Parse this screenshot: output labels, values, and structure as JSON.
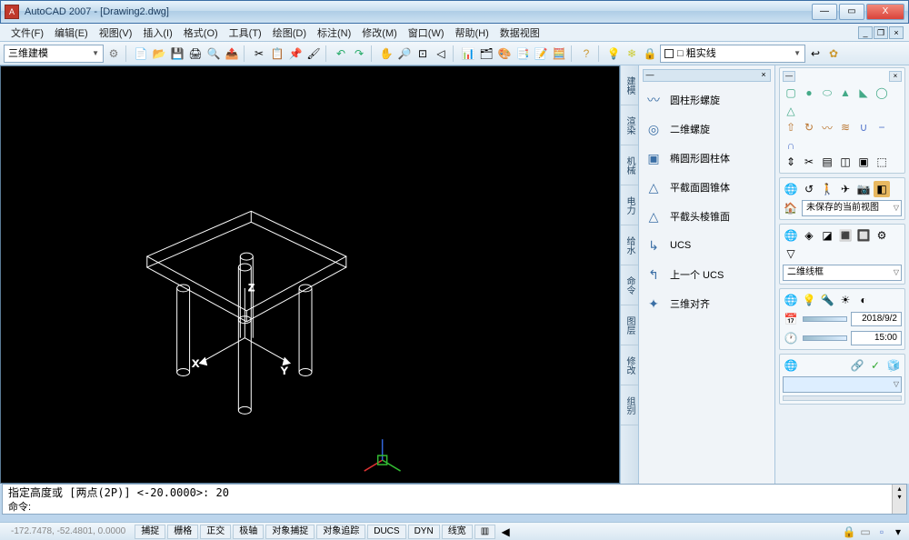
{
  "window": {
    "title": "AutoCAD 2007 - [Drawing2.dwg]",
    "min": "—",
    "max": "▭",
    "close": "X"
  },
  "mdi": {
    "min": "_",
    "restore": "❐",
    "close": "×"
  },
  "menus": [
    "文件(F)",
    "编辑(E)",
    "视图(V)",
    "插入(I)",
    "格式(O)",
    "工具(T)",
    "绘图(D)",
    "标注(N)",
    "修改(M)",
    "窗口(W)",
    "帮助(H)",
    "数据视图"
  ],
  "workspace": {
    "selected": "三维建模"
  },
  "layer": {
    "combo": "□ 粗实线"
  },
  "right_panel": {
    "tabs": [
      "建模",
      "渲染",
      "机械",
      "电力",
      "给水",
      "命令",
      "图层",
      "修改",
      "组别"
    ],
    "items": [
      {
        "icon": "〰",
        "label": "圆柱形螺旋"
      },
      {
        "icon": "◎",
        "label": "二维螺旋"
      },
      {
        "icon": "▣",
        "label": "椭圆形圆柱体"
      },
      {
        "icon": "△",
        "label": "平截面圆锥体"
      },
      {
        "icon": "△",
        "label": "平截头棱锥面"
      },
      {
        "icon": "↳",
        "label": "UCS"
      },
      {
        "icon": "↰",
        "label": "上一个 UCS"
      },
      {
        "icon": "✦",
        "label": "三维对齐"
      }
    ]
  },
  "prop": {
    "view": {
      "combo": "未保存的当前视图",
      "wire": "二维线框"
    },
    "date": "2018/9/2",
    "time": "15:00"
  },
  "command": {
    "line1": "指定高度或 [两点(2P)] <-20.0000>: 20",
    "prompt": "命令:"
  },
  "status": {
    "coords": "-172.7478, -52.4801, 0.0000",
    "toggles": [
      "捕捉",
      "栅格",
      "正交",
      "极轴",
      "对象捕捉",
      "对象追踪",
      "DUCS",
      "DYN",
      "线宽"
    ]
  }
}
